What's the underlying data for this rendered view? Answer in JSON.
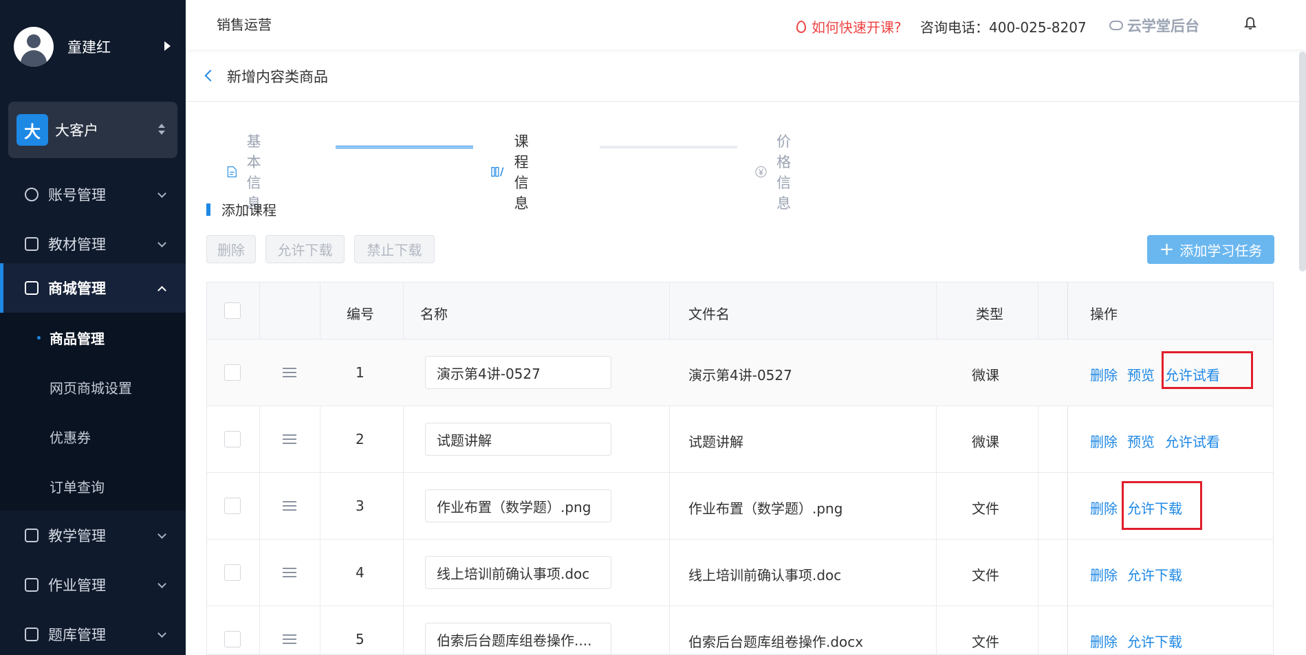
{
  "sidebar": {
    "user_name": "童建红",
    "org_badge": "大",
    "org_name": "大客户",
    "menu": {
      "account": "账号管理",
      "textbook": "教材管理",
      "mall": "商城管理",
      "teaching": "教学管理",
      "homework": "作业管理",
      "question_bank": "题库管理"
    },
    "submenu": [
      "商品管理",
      "网页商城设置",
      "优惠券",
      "订单查询"
    ]
  },
  "header": {
    "section": "销售运营",
    "howto": "如何快速开课?",
    "phone": "咨询电话：400-025-8207",
    "brand": "云学堂后台"
  },
  "breadcrumb": {
    "title": "新增内容类商品"
  },
  "steps": [
    "基本信息",
    "课程信息",
    "价格信息"
  ],
  "section": {
    "title": "添加课程",
    "btn_delete": "删除",
    "btn_allow_download": "允许下载",
    "btn_forbid_download": "禁止下载",
    "btn_add_task": "添加学习任务"
  },
  "table": {
    "headers": {
      "id": "编号",
      "name": "名称",
      "file": "文件名",
      "type": "类型",
      "ops": "操作"
    },
    "rows": [
      {
        "id": "1",
        "name": "演示第4讲-0527",
        "file": "演示第4讲-0527",
        "type": "微课",
        "ops": [
          "删除",
          "预览",
          "允许试看"
        ]
      },
      {
        "id": "2",
        "name": "试题讲解",
        "file": "试题讲解",
        "type": "微课",
        "ops": [
          "删除",
          "预览",
          "允许试看"
        ]
      },
      {
        "id": "3",
        "name": "作业布置（数学题）.png",
        "file": "作业布置（数学题）.png",
        "type": "文件",
        "ops": [
          "删除",
          "允许下载"
        ]
      },
      {
        "id": "4",
        "name": "线上培训前确认事项.doc",
        "file": "线上培训前确认事项.doc",
        "type": "文件",
        "ops": [
          "删除",
          "允许下载"
        ]
      },
      {
        "id": "5",
        "name": "伯索后台题库组卷操作....",
        "file": "伯索后台题库组卷操作.docx",
        "type": "文件",
        "ops": [
          "删除",
          "允许下载"
        ]
      }
    ]
  },
  "colors": {
    "accent": "#1e88e5",
    "sidebar_bg": "#0f1a2c",
    "highlight_border": "#e11d2a",
    "warning_text": "#ef4444"
  }
}
